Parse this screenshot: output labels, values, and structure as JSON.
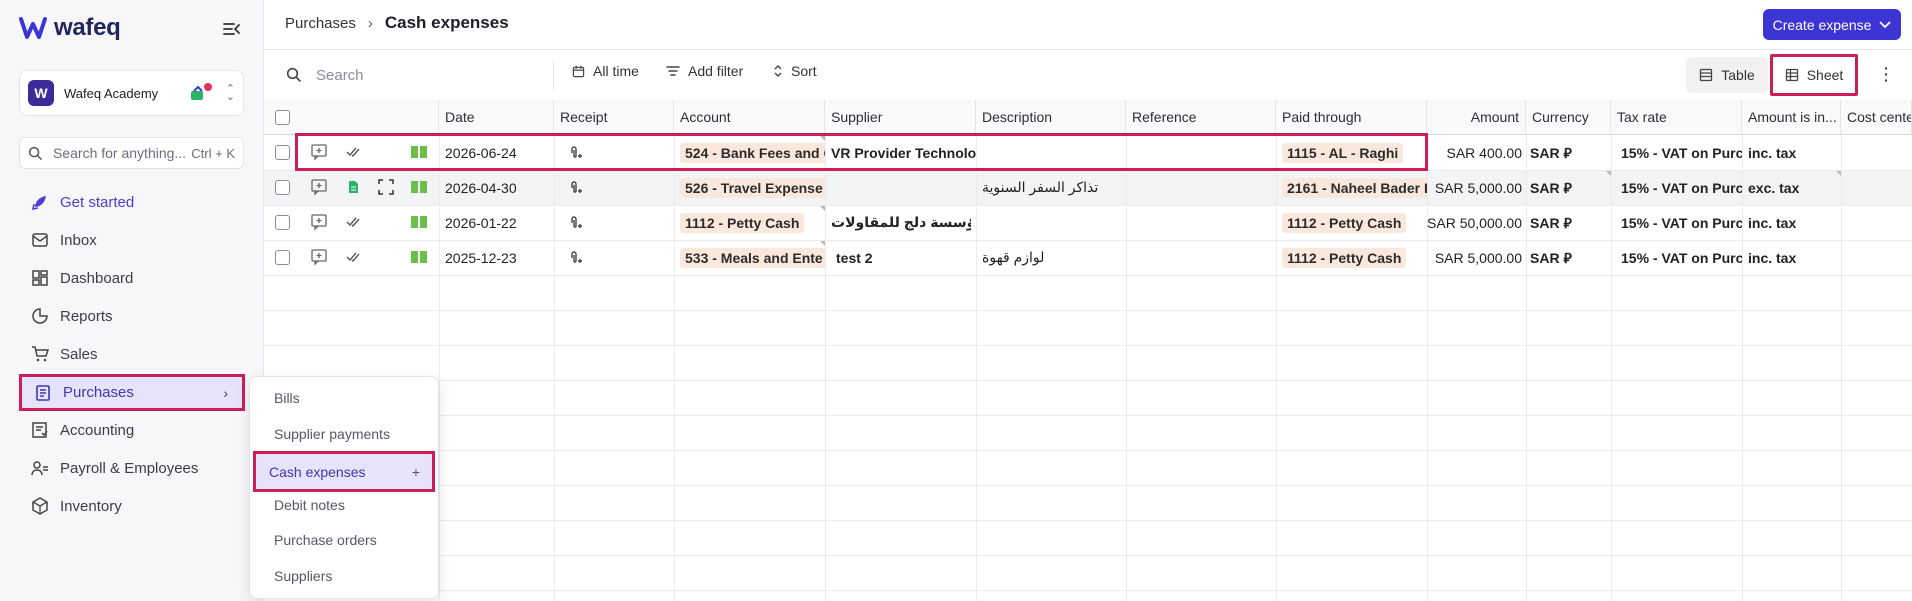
{
  "app": {
    "logo_text": "wafeq"
  },
  "org": {
    "name": "Wafeq Academy",
    "avatar_letter": "W"
  },
  "search_anything": {
    "placeholder": "Search for anything...",
    "shortcut": "Ctrl + K"
  },
  "sidebar": {
    "items": [
      {
        "label": "Get started",
        "icon": "rocket-icon"
      },
      {
        "label": "Inbox",
        "icon": "inbox-icon"
      },
      {
        "label": "Dashboard",
        "icon": "dashboard-icon"
      },
      {
        "label": "Reports",
        "icon": "reports-icon"
      },
      {
        "label": "Sales",
        "icon": "cart-icon"
      },
      {
        "label": "Purchases",
        "icon": "receipt-icon"
      },
      {
        "label": "Accounting",
        "icon": "ledger-icon"
      },
      {
        "label": "Payroll & Employees",
        "icon": "people-icon"
      },
      {
        "label": "Inventory",
        "icon": "box-icon"
      }
    ]
  },
  "submenu": {
    "items": [
      {
        "label": "Bills"
      },
      {
        "label": "Supplier payments"
      },
      {
        "label": "Cash expenses",
        "action": "+"
      },
      {
        "label": "Debit notes"
      },
      {
        "label": "Purchase orders"
      },
      {
        "label": "Suppliers"
      }
    ]
  },
  "header": {
    "breadcrumb_parent": "Purchases",
    "separator": "›",
    "title": "Cash expenses",
    "create_label": "Create expense"
  },
  "toolbar": {
    "search_placeholder": "Search",
    "all_time": "All time",
    "add_filter": "Add filter",
    "sort": "Sort",
    "view_table": "Table",
    "view_sheet": "Sheet",
    "more": "⋮"
  },
  "colors": {
    "accent": "#3d34d6",
    "highlight": "#cc1f57",
    "tag_bg": "#fbe8dc",
    "selected_nav_bg": "#e6e4fb"
  },
  "table": {
    "columns": [
      "Date",
      "Receipt",
      "Account",
      "Supplier",
      "Description",
      "Reference",
      "Paid through",
      "Amount",
      "Currency",
      "Tax rate",
      "Amount is in...",
      "Cost cente"
    ],
    "rows": [
      {
        "date": "2026-06-24",
        "account": "524 - Bank Fees and C",
        "supplier": "VR Provider Technolo",
        "description": "",
        "reference": "",
        "paid_through": "1115 - AL - Raghi",
        "amount": "SAR 400.00",
        "currency": "SAR ⃁",
        "tax_rate": "15% - VAT on Purc",
        "amount_is": "inc. tax"
      },
      {
        "date": "2026-04-30",
        "account": "526 - Travel Expense",
        "supplier": "",
        "description": "تذاكر السفر السنوية",
        "reference": "",
        "paid_through": "2161 - Naheel Bader F",
        "amount": "SAR 5,000.00",
        "currency": "SAR ⃁",
        "tax_rate": "15% - VAT on Purc",
        "amount_is": "exc. tax"
      },
      {
        "date": "2026-01-22",
        "account": "1112 - Petty Cash",
        "supplier": "مؤسسة دلج للمقاولات",
        "description": "",
        "reference": "",
        "paid_through": "1112 - Petty Cash",
        "amount": "SAR 50,000.00",
        "currency": "SAR ⃁",
        "tax_rate": "15% - VAT on Purc",
        "amount_is": "inc. tax"
      },
      {
        "date": "2025-12-23",
        "account": "533 - Meals and Ente",
        "supplier": "test 2",
        "description": "لوازم قهوة",
        "reference": "",
        "paid_through": "1112 - Petty Cash",
        "amount": "SAR 5,000.00",
        "currency": "SAR ⃁",
        "tax_rate": "15% - VAT on Purc",
        "amount_is": "inc. tax"
      }
    ]
  }
}
